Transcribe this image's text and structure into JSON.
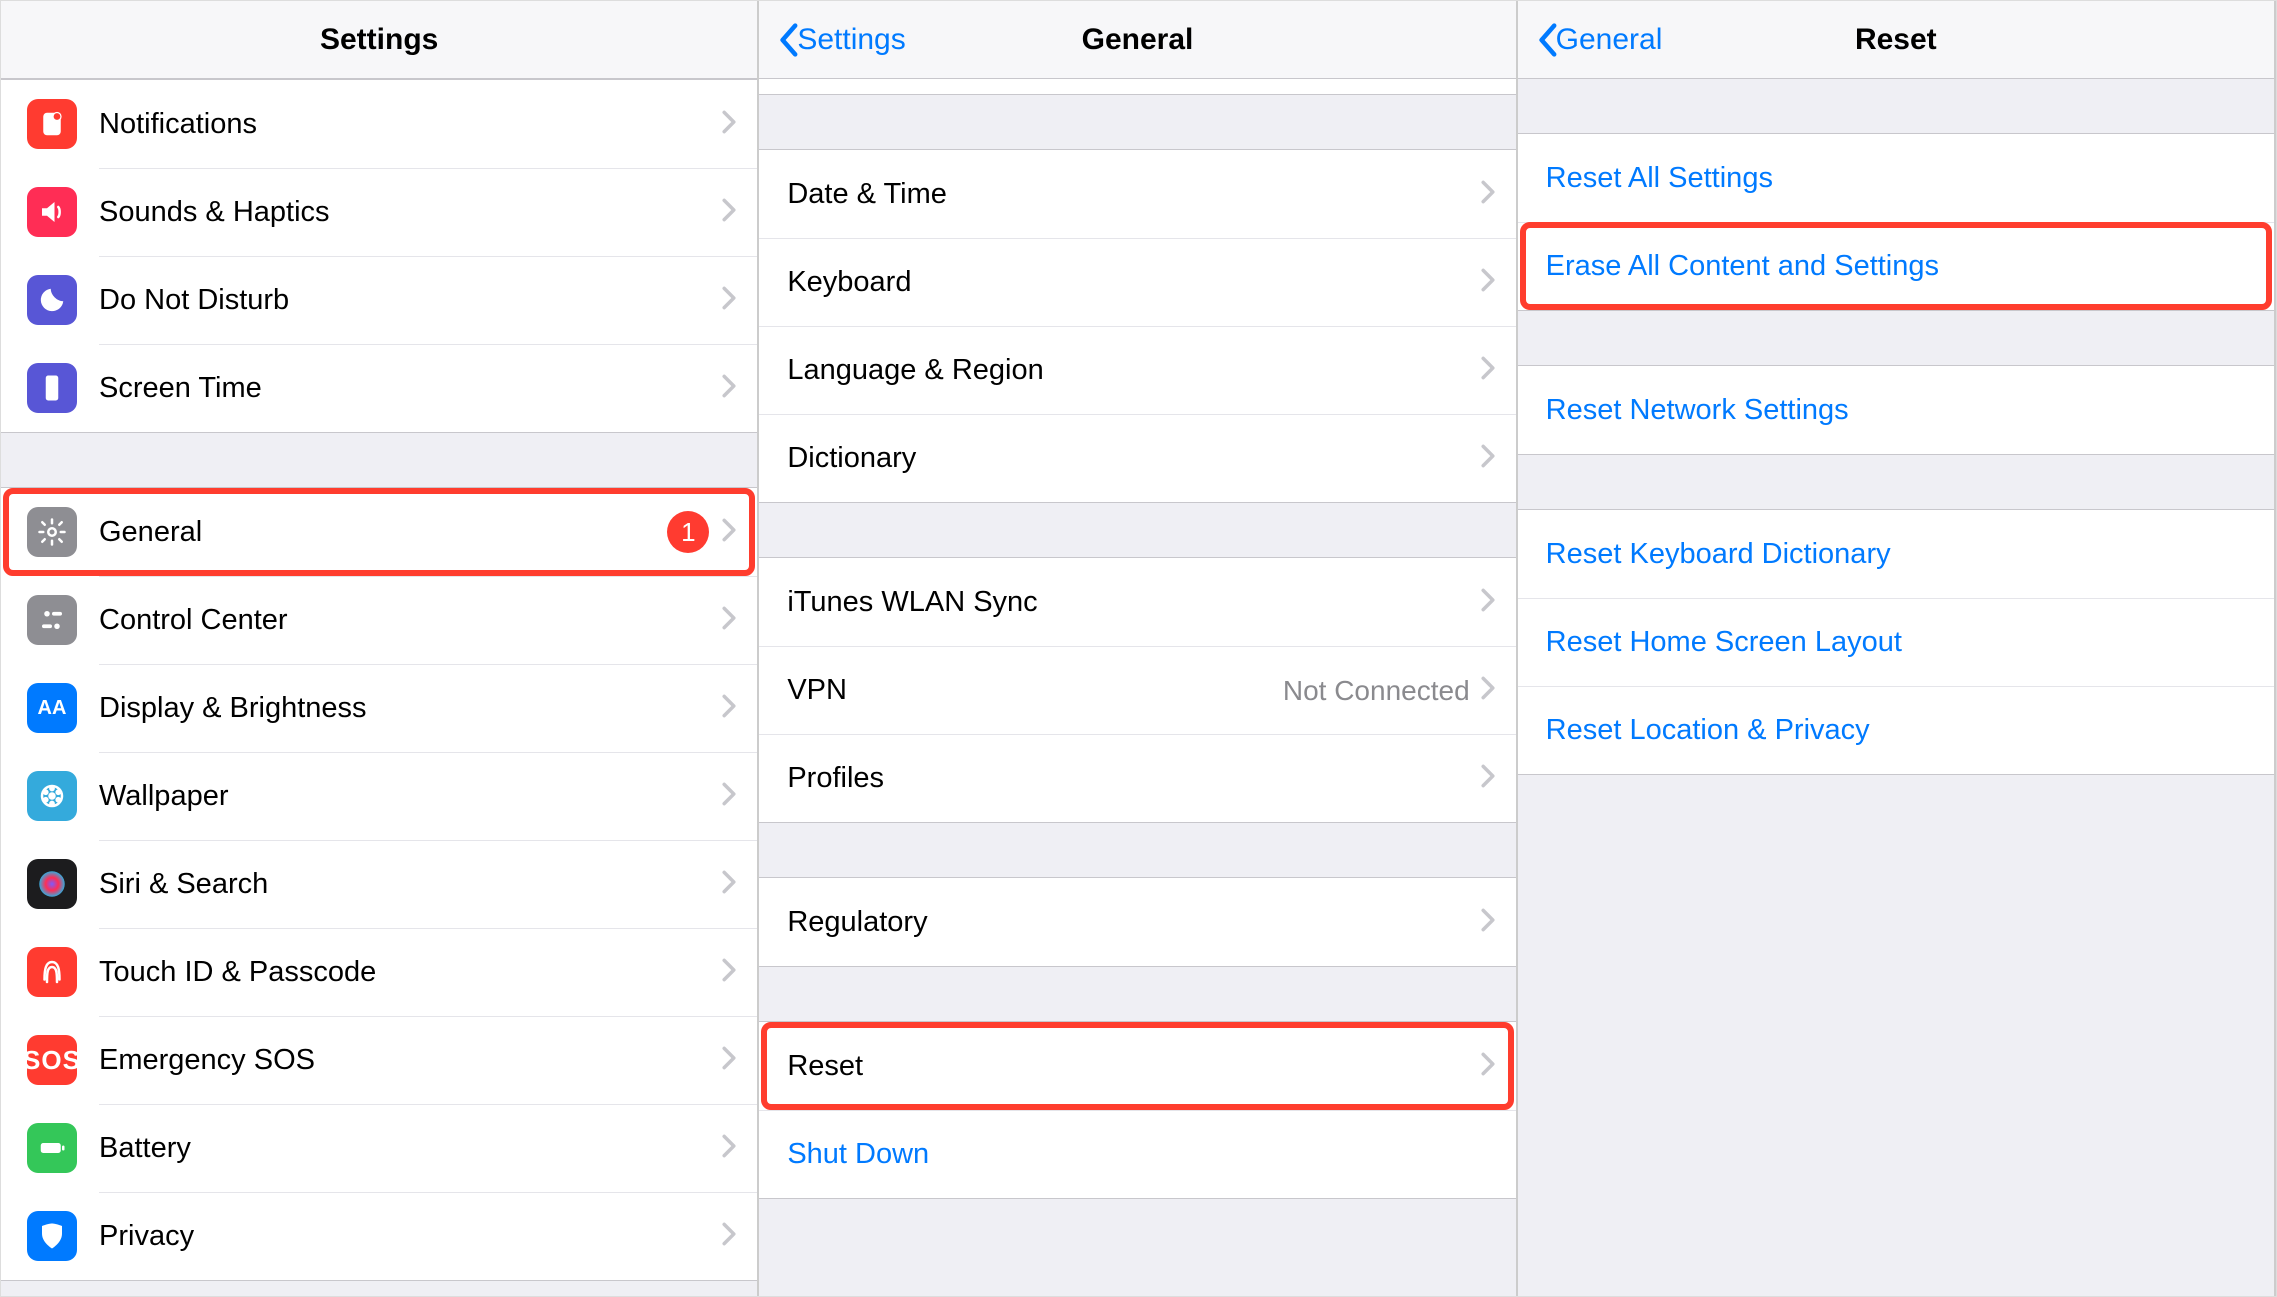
{
  "panel1": {
    "title": "Settings",
    "group1": [
      {
        "label": "Notifications",
        "icon": "notifications-icon",
        "color": "ic-red"
      },
      {
        "label": "Sounds & Haptics",
        "icon": "sounds-icon",
        "color": "ic-pink"
      },
      {
        "label": "Do Not Disturb",
        "icon": "dnd-icon",
        "color": "ic-purple"
      },
      {
        "label": "Screen Time",
        "icon": "screentime-icon",
        "color": "ic-purple"
      }
    ],
    "group2": [
      {
        "label": "General",
        "icon": "general-icon",
        "color": "ic-gray",
        "badge": "1",
        "highlight": true
      },
      {
        "label": "Control Center",
        "icon": "controlcenter-icon",
        "color": "ic-gray"
      },
      {
        "label": "Display & Brightness",
        "icon": "display-icon",
        "color": "ic-blue"
      },
      {
        "label": "Wallpaper",
        "icon": "wallpaper-icon",
        "color": "ic-teal"
      },
      {
        "label": "Siri & Search",
        "icon": "siri-icon",
        "color": "ic-navy"
      },
      {
        "label": "Touch ID & Passcode",
        "icon": "touchid-icon",
        "color": "ic-red"
      },
      {
        "label": "Emergency SOS",
        "icon": "sos-icon",
        "color": "ic-sos"
      },
      {
        "label": "Battery",
        "icon": "battery-icon",
        "color": "ic-green"
      },
      {
        "label": "Privacy",
        "icon": "privacy-icon",
        "color": "ic-blue"
      }
    ]
  },
  "panel2": {
    "back": "Settings",
    "title": "General",
    "group1": [
      {
        "label": "Date & Time"
      },
      {
        "label": "Keyboard"
      },
      {
        "label": "Language & Region"
      },
      {
        "label": "Dictionary"
      }
    ],
    "group2": [
      {
        "label": "iTunes WLAN Sync"
      },
      {
        "label": "VPN",
        "detail": "Not Connected"
      },
      {
        "label": "Profiles"
      }
    ],
    "group3": [
      {
        "label": "Regulatory"
      }
    ],
    "group4": [
      {
        "label": "Reset",
        "highlight": true
      },
      {
        "label": "Shut Down",
        "link": true,
        "noChevron": true
      }
    ]
  },
  "panel3": {
    "back": "General",
    "title": "Reset",
    "group1": [
      {
        "label": "Reset All Settings",
        "link": true
      },
      {
        "label": "Erase All Content and Settings",
        "link": true,
        "highlight": true
      }
    ],
    "group2": [
      {
        "label": "Reset Network Settings",
        "link": true
      }
    ],
    "group3": [
      {
        "label": "Reset Keyboard Dictionary",
        "link": true
      },
      {
        "label": "Reset Home Screen Layout",
        "link": true
      },
      {
        "label": "Reset Location & Privacy",
        "link": true
      }
    ]
  }
}
